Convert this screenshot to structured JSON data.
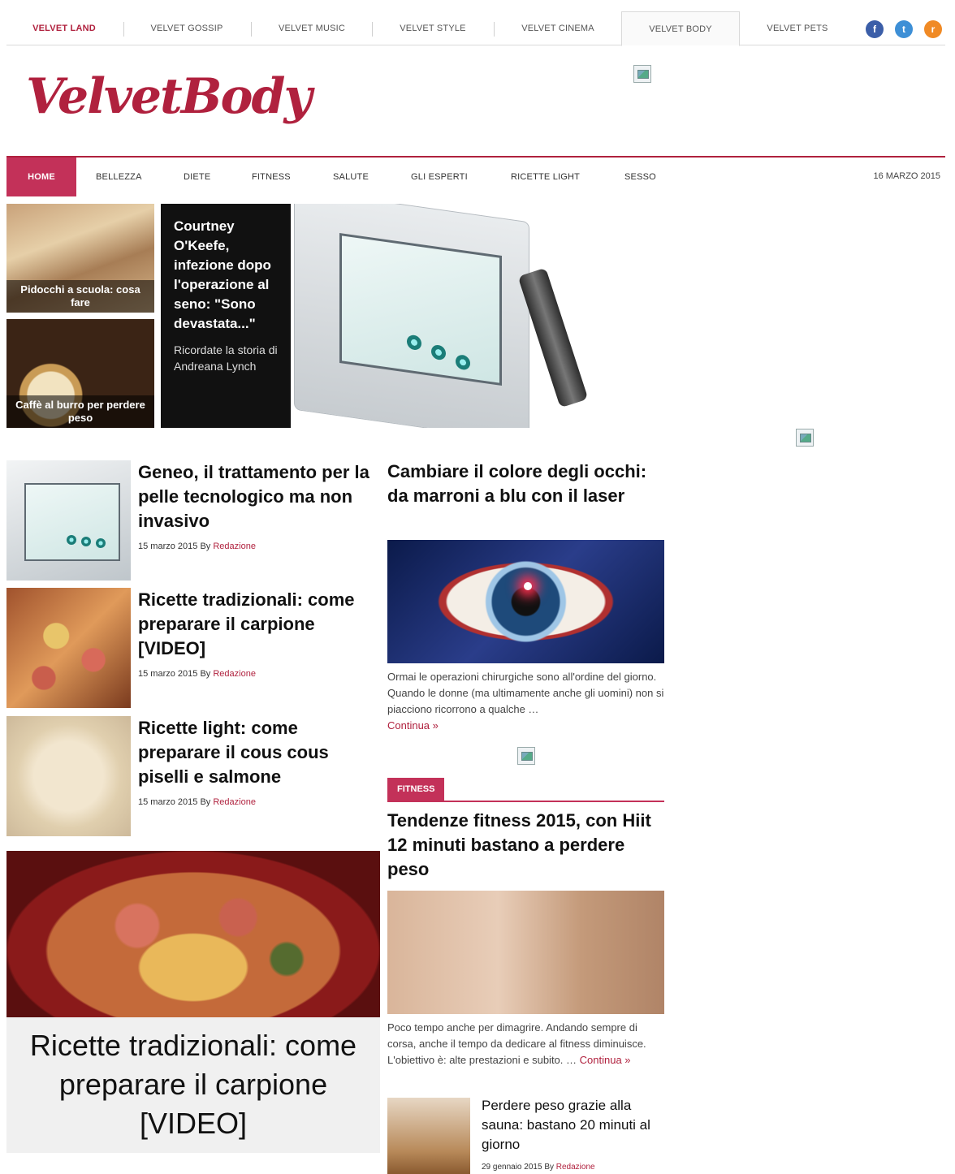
{
  "network": {
    "items": [
      {
        "label": "VELVET LAND"
      },
      {
        "label": "VELVET GOSSIP"
      },
      {
        "label": "VELVET MUSIC"
      },
      {
        "label": "VELVET STYLE"
      },
      {
        "label": "VELVET CINEMA"
      },
      {
        "label": "VELVET BODY"
      },
      {
        "label": "VELVET PETS"
      }
    ],
    "social": {
      "facebook": "f",
      "twitter": "t",
      "rss": "r"
    }
  },
  "logo": {
    "text": "VelvetBody"
  },
  "nav": {
    "items": [
      {
        "label": "HOME"
      },
      {
        "label": "BELLEZZA"
      },
      {
        "label": "DIETE"
      },
      {
        "label": "FITNESS"
      },
      {
        "label": "SALUTE"
      },
      {
        "label": "GLI ESPERTI"
      },
      {
        "label": "RICETTE LIGHT"
      },
      {
        "label": "SESSO"
      }
    ],
    "date": "16 MARZO 2015"
  },
  "hero": {
    "thumbs": [
      {
        "caption": "Pidocchi a scuola: cosa fare"
      },
      {
        "caption": "Caffè al burro per perdere peso"
      }
    ],
    "feature": {
      "title": "Courtney O'Keefe, infezione dopo l'operazione al seno: \"Sono devastata...\"",
      "excerpt": "Ricordate la storia di Andreana Lynch"
    }
  },
  "articles": [
    {
      "title": "Geneo, il trattamento per la pelle tecnologico ma non invasivo",
      "date": "15 marzo 2015",
      "by": "By",
      "author": "Redazione"
    },
    {
      "title": "Ricette tradizionali: come preparare il carpione [VIDEO]",
      "date": "15 marzo 2015",
      "by": "By",
      "author": "Redazione"
    },
    {
      "title": "Ricette light: come preparare il cous cous piselli e salmone",
      "date": "15 marzo 2015",
      "by": "By",
      "author": "Redazione"
    }
  ],
  "big_card": {
    "title": "Ricette tradizionali: come preparare il carpione [VIDEO]"
  },
  "middle": {
    "eyes": {
      "title": "Cambiare il colore degli occhi: da marroni a blu con il laser",
      "excerpt": "Ormai le operazioni chirurgiche sono all'ordine del giorno. Quando le donne (ma ultimamente anche gli uomini) non si piacciono ricorrono a qualche …",
      "more": "Continua »"
    },
    "section": "FITNESS",
    "fitness": {
      "title": "Tendenze fitness 2015, con Hiit 12 minuti bastano a perdere peso",
      "excerpt": "Poco tempo anche per dimagrire. Andando sempre di corsa, anche il tempo da dedicare al fitness diminuisce. L'obiettivo è: alte prestazioni e subito. …",
      "more": "Continua »"
    },
    "sauna": {
      "title": "Perdere peso grazie alla sauna: bastano 20 minuti al giorno",
      "date": "29 gennaio 2015",
      "by": "By",
      "author": "Redazione"
    }
  },
  "colors": {
    "brand": "#b0213e",
    "nav_active": "#c33159"
  }
}
